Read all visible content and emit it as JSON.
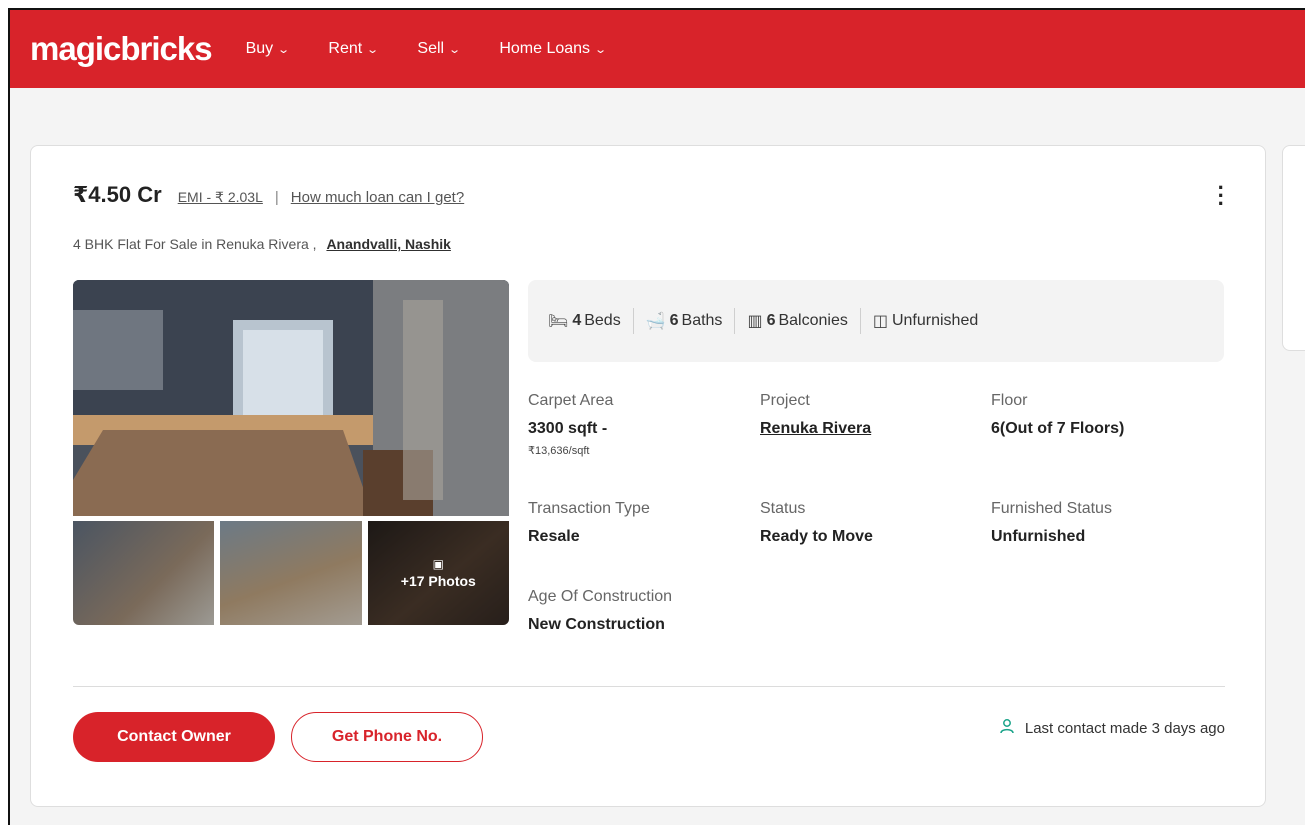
{
  "header": {
    "logo": "magicbricks",
    "nav": [
      "Buy",
      "Rent",
      "Sell",
      "Home Loans"
    ],
    "brand_color": "#d8232a"
  },
  "listing": {
    "price": "₹4.50 Cr",
    "emi": "EMI - ₹ 2.03L",
    "separator": "|",
    "loan_link": "How much loan can I get?",
    "title": "4 BHK Flat For Sale in Renuka Rivera ,",
    "location": "Anandvalli, Nashik",
    "photos_more": "+17 Photos",
    "amenities": [
      {
        "icon": "bed-icon",
        "value": "4",
        "label": "Beds"
      },
      {
        "icon": "bath-icon",
        "value": "6",
        "label": "Baths"
      },
      {
        "icon": "balcony-icon",
        "value": "6",
        "label": "Balconies"
      },
      {
        "icon": "furnish-icon",
        "value": "",
        "label": "Unfurnished"
      }
    ],
    "facts": {
      "carpet_area": {
        "label": "Carpet Area",
        "value": "3300 sqft -",
        "sub": "₹13,636/sqft"
      },
      "project": {
        "label": "Project",
        "value": "Renuka Rivera"
      },
      "floor": {
        "label": "Floor",
        "value": "6(Out of 7 Floors)"
      },
      "transaction": {
        "label": "Transaction Type",
        "value": "Resale"
      },
      "status": {
        "label": "Status",
        "value": "Ready to Move"
      },
      "furnished": {
        "label": "Furnished Status",
        "value": "Unfurnished"
      },
      "age": {
        "label": "Age Of Construction",
        "value": "New Construction"
      }
    },
    "actions": {
      "contact": "Contact Owner",
      "phone": "Get Phone No."
    },
    "last_contact": "Last contact made 3 days ago"
  }
}
